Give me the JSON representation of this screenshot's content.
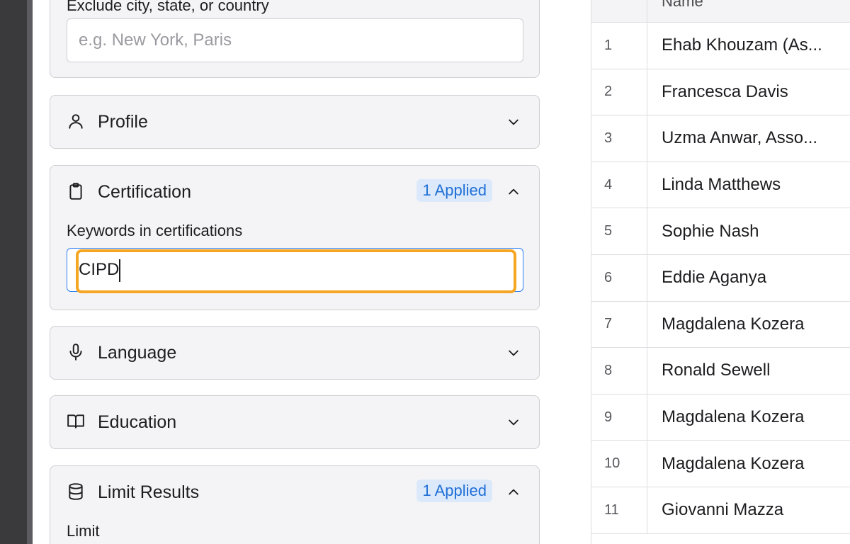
{
  "location": {
    "exclude_label": "Exclude city, state, or country",
    "exclude_placeholder": "e.g. New York, Paris"
  },
  "sections": {
    "profile": {
      "title": "Profile",
      "icon": "person-icon"
    },
    "certification": {
      "title": "Certification",
      "icon": "clipboard-icon",
      "badge": "1 Applied",
      "field_label": "Keywords in certifications",
      "field_value": "CIPD"
    },
    "language": {
      "title": "Language",
      "icon": "microphone-icon"
    },
    "education": {
      "title": "Education",
      "icon": "book-icon"
    },
    "limit_results": {
      "title": "Limit Results",
      "icon": "database-icon",
      "badge": "1 Applied",
      "field_label": "Limit"
    }
  },
  "colors": {
    "highlight": "#f5a623",
    "badge_bg": "#dce9fb",
    "badge_text": "#1f6fd6",
    "focus_border": "#2f7ff0"
  },
  "table": {
    "header_name": "Name",
    "rows": [
      {
        "num": "1",
        "name": "Ehab Khouzam (As..."
      },
      {
        "num": "2",
        "name": "Francesca Davis"
      },
      {
        "num": "3",
        "name": "Uzma Anwar, Asso..."
      },
      {
        "num": "4",
        "name": "Linda Matthews"
      },
      {
        "num": "5",
        "name": "Sophie Nash"
      },
      {
        "num": "6",
        "name": "Eddie Aganya"
      },
      {
        "num": "7",
        "name": "Magdalena Kozera"
      },
      {
        "num": "8",
        "name": "Ronald Sewell"
      },
      {
        "num": "9",
        "name": "Magdalena Kozera"
      },
      {
        "num": "10",
        "name": "Magdalena Kozera"
      },
      {
        "num": "11",
        "name": "Giovanni Mazza"
      }
    ]
  }
}
